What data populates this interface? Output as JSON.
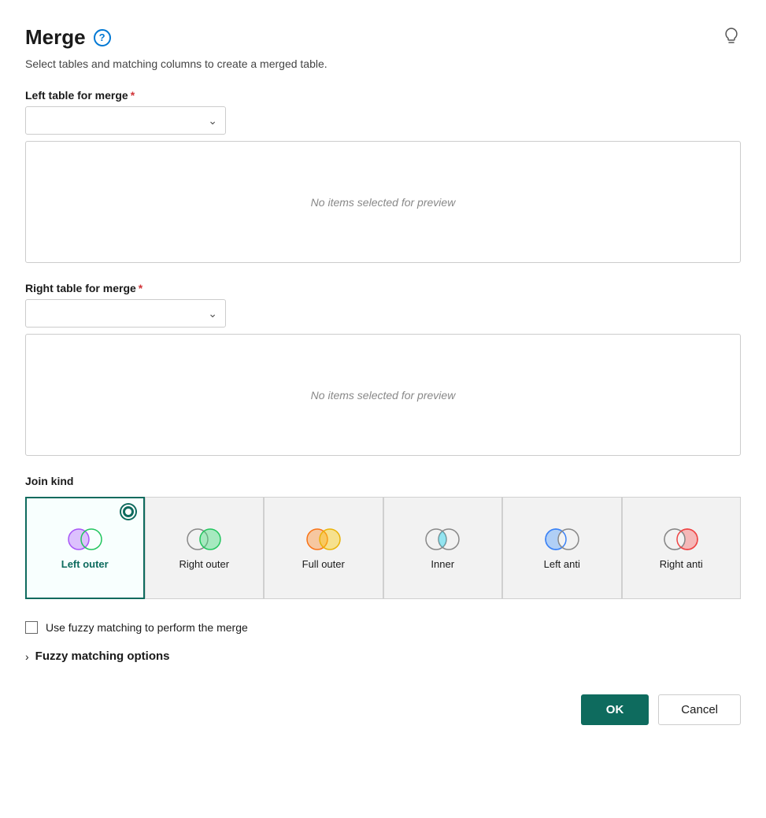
{
  "header": {
    "title": "Merge",
    "subtitle": "Select tables and matching columns to create a merged table.",
    "help_icon_label": "?",
    "lightbulb_icon": "💡"
  },
  "left_table": {
    "label": "Left table for merge",
    "required": true,
    "placeholder": "",
    "preview_text": "No items selected for preview"
  },
  "right_table": {
    "label": "Right table for merge",
    "required": true,
    "placeholder": "",
    "preview_text": "No items selected for preview"
  },
  "join_kind": {
    "label": "Join kind",
    "options": [
      {
        "id": "left-outer",
        "label": "Left outer",
        "selected": true
      },
      {
        "id": "right-outer",
        "label": "Right outer",
        "selected": false
      },
      {
        "id": "full-outer",
        "label": "Full outer",
        "selected": false
      },
      {
        "id": "inner",
        "label": "Inner",
        "selected": false
      },
      {
        "id": "left-anti",
        "label": "Left anti",
        "selected": false
      },
      {
        "id": "right-anti",
        "label": "Right anti",
        "selected": false
      }
    ]
  },
  "fuzzy": {
    "checkbox_label": "Use fuzzy matching to perform the merge",
    "options_label": "Fuzzy matching options",
    "checked": false
  },
  "footer": {
    "ok_label": "OK",
    "cancel_label": "Cancel"
  }
}
